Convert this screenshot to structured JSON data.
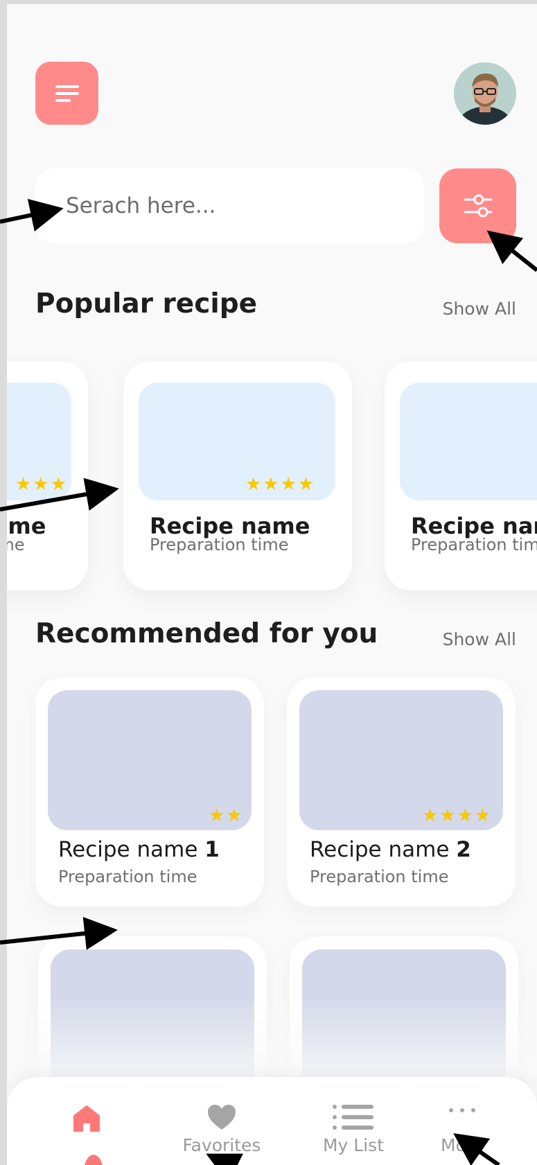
{
  "search": {
    "placeholder": "Serach here..."
  },
  "sections": {
    "popular_title": "Popular recipe",
    "popular_show_all": "Show All",
    "recommended_title": "Recommended for you",
    "recommended_show_all": "Show All"
  },
  "popular": [
    {
      "name": "Recipe name",
      "time": "Preparation time",
      "stars": "★★★"
    },
    {
      "name": "Recipe name",
      "time": "Preparation time",
      "stars": "★★★★"
    },
    {
      "name": "Recipe name",
      "time": "Preparation time",
      "stars": ""
    }
  ],
  "recommended": [
    {
      "name": "Recipe name",
      "number": "1",
      "time": "Preparation time",
      "stars": "★★"
    },
    {
      "name": "Recipe name",
      "number": "2",
      "time": "Preparation time",
      "stars": "★★★★"
    }
  ],
  "nav": {
    "favorites": "Favorites",
    "my_list": "My List",
    "more": "More"
  },
  "colors": {
    "accent": "#ff8a8a",
    "star": "#f7c900",
    "popular_image": "#e2effc",
    "recommended_image": "#d3d8ea"
  },
  "icons": {
    "menu": "menu-lines-icon",
    "filter": "sliders-icon",
    "home": "home-icon",
    "favorites": "heart-icon",
    "my_list": "list-icon",
    "more": "dots-icon"
  }
}
